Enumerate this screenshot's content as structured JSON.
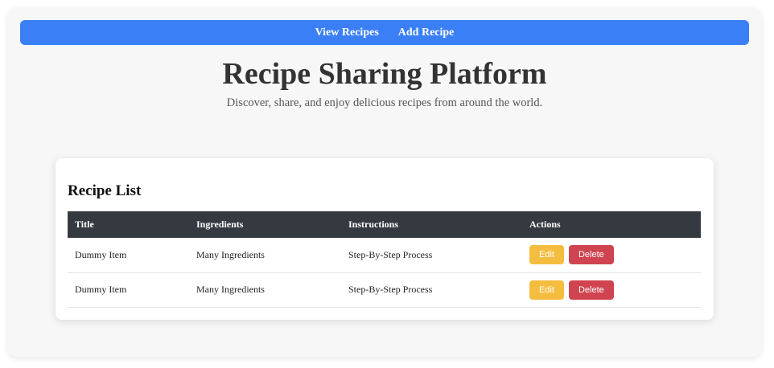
{
  "nav": {
    "items": [
      {
        "label": "View Recipes"
      },
      {
        "label": "Add Recipe"
      }
    ]
  },
  "header": {
    "title": "Recipe Sharing Platform",
    "subtitle": "Discover, share, and enjoy delicious recipes from around the world."
  },
  "recipes": {
    "heading": "Recipe List",
    "columns": [
      "Title",
      "Ingredients",
      "Instructions",
      "Actions"
    ],
    "rows": [
      {
        "title": "Dummy Item",
        "ingredients": "Many Ingredients",
        "instructions": "Step-By-Step Process",
        "edit_label": "Edit",
        "delete_label": "Delete"
      },
      {
        "title": "Dummy Item",
        "ingredients": "Many Ingredients",
        "instructions": "Step-By-Step Process",
        "edit_label": "Edit",
        "delete_label": "Delete"
      }
    ]
  },
  "colors": {
    "navbar": "#3a7ff6",
    "table_header": "#343a40",
    "edit_button": "#f5bd3f",
    "delete_button": "#cf4450"
  }
}
